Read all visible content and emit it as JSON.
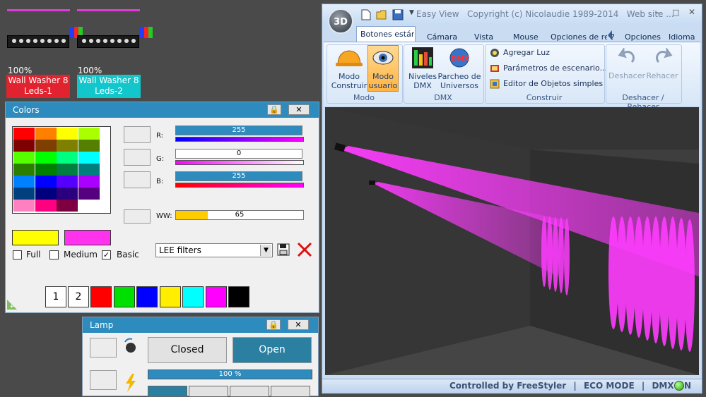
{
  "fixtures": [
    {
      "percent": "100%",
      "label_line1": "Wall Washer 8",
      "label_line2": "Leds-1",
      "color": "#e0232e"
    },
    {
      "percent": "100%",
      "label_line1": "Wall Washer 8",
      "label_line2": "Leds-2",
      "color": "#12c6cc"
    }
  ],
  "colors_panel": {
    "title": "Colors",
    "grid": [
      "#ff0000",
      "#ff8000",
      "#ffff00",
      "#aaff00",
      "#7f0000",
      "#7f3f00",
      "#7f7f00",
      "#557f00",
      "#55ff00",
      "#00ff00",
      "#00ff80",
      "#00ffff",
      "#2a7f00",
      "#007f00",
      "#007f40",
      "#007f7f",
      "#0080ff",
      "#0000ff",
      "#5500ff",
      "#aa00ff",
      "#00407f",
      "#00007f",
      "#2a007f",
      "#55007f",
      "#ff80c0",
      "#ff0080",
      "#7f0040",
      "#ffffff"
    ],
    "current_color_a": "#ffff00",
    "current_color_b": "#ff33ee",
    "r_label": "R:",
    "r_value": "255",
    "g_label": "G:",
    "g_value": "0",
    "b_label": "B:",
    "b_value": "255",
    "ww_label": "WW:",
    "ww_value": "65",
    "checks": {
      "full": "Full",
      "medium": "Medium",
      "basic": "Basic",
      "checkmark": "✓"
    },
    "filter_select": "LEE filters",
    "palette_numbers": [
      "1",
      "2"
    ],
    "palette_colors": [
      "#ff0000",
      "#00e000",
      "#0000ff",
      "#ffee00",
      "#00ffff",
      "#ff00ff",
      "#000000"
    ]
  },
  "lamp_panel": {
    "title": "Lamp",
    "closed": "Closed",
    "open": "Open",
    "progress": "100 %",
    "progress_value": 1.0
  },
  "easyview": {
    "title": "Easy View   Copyright (c) Nicolaudie 1989-2014   Web site ...",
    "logo": "3D",
    "tabs": [
      "Botones estánc",
      "Cámara",
      "Vista",
      "Mouse",
      "Opciones de re"
    ],
    "right_menu": [
      "?",
      "Opciones",
      "Idioma"
    ],
    "modo_construir": [
      "Modo",
      "Construir"
    ],
    "modo_usuario": [
      "Modo",
      "usuario"
    ],
    "niveles": [
      "Niveles",
      "DMX"
    ],
    "parcheo": [
      "Parcheo de",
      "Universos"
    ],
    "group_modo": "Modo",
    "group_dmx": "DMX",
    "cmd_agregar": "Agregar Luz",
    "cmd_parametros": "Parámetros de escenario...",
    "cmd_editor": "Editor de Objetos simples",
    "group_construir": "Construir",
    "deshacer": "Deshacer",
    "rehacer": "Rehacer",
    "group_undo": "Deshacer / Rehacer",
    "status": {
      "controlled": "Controlled by FreeStyler",
      "eco": "ECO MODE",
      "dmx": "DMX ON",
      "sep": "|"
    },
    "beam_color": "#ff3cff"
  }
}
